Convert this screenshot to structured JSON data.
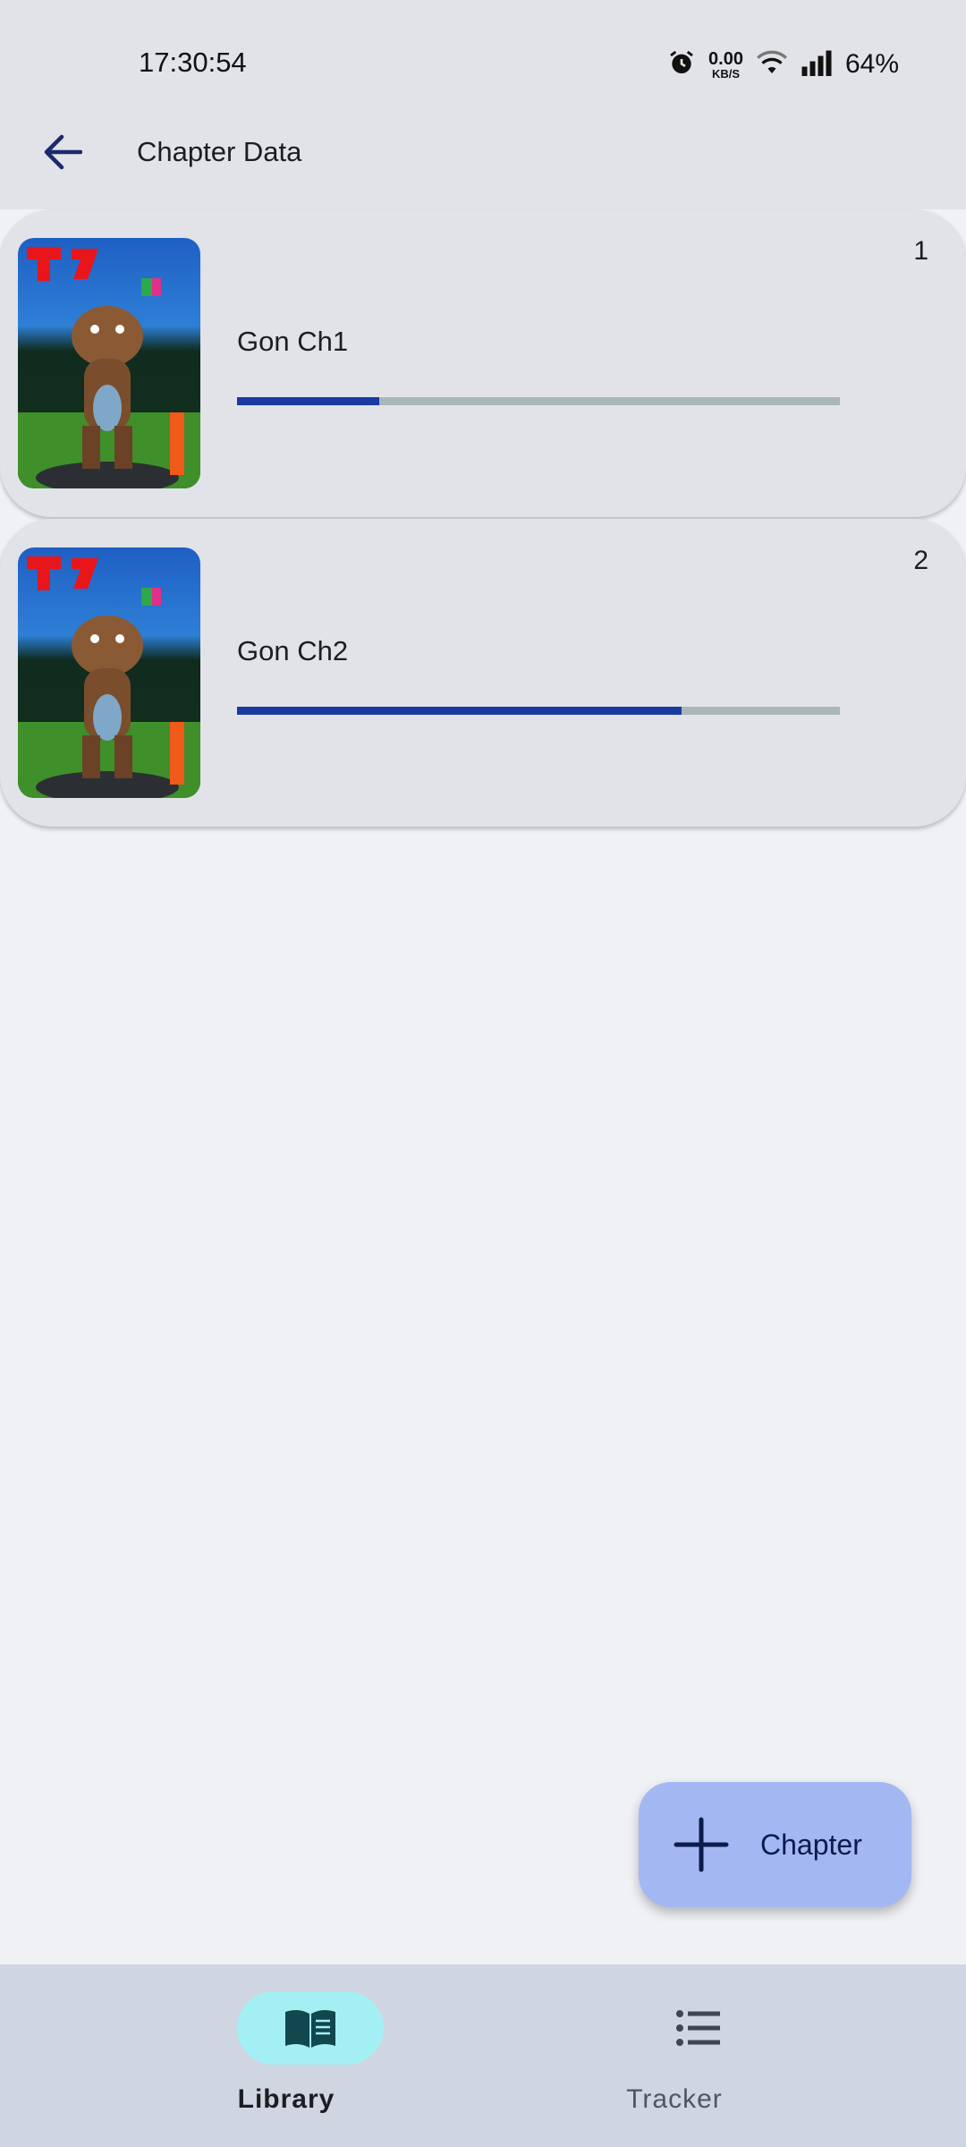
{
  "status_bar": {
    "time": "17:30:54",
    "net_speed_value": "0.00",
    "net_speed_unit": "KB/S",
    "battery": "64%",
    "icons": [
      "alarm-icon",
      "wifi-icon",
      "signal-icon"
    ]
  },
  "app_bar": {
    "title": "Chapter Data",
    "back_icon": "arrow-back-icon"
  },
  "chapters": [
    {
      "name": "Gon Ch1",
      "number": "1",
      "progress": 0.236
    },
    {
      "name": "Gon Ch2",
      "number": "2",
      "progress": 0.737
    }
  ],
  "fab": {
    "label": "Chapter",
    "icon": "plus-icon"
  },
  "bottom_nav": {
    "items": [
      {
        "label": "Library",
        "icon": "book-open-icon",
        "active": true
      },
      {
        "label": "Tracker",
        "icon": "list-icon",
        "active": false
      }
    ]
  },
  "colors": {
    "accent": "#1a3aa2",
    "track": "#a9b7b9",
    "fab": "#a3b7f3",
    "nav_active": "#a4eff3"
  }
}
